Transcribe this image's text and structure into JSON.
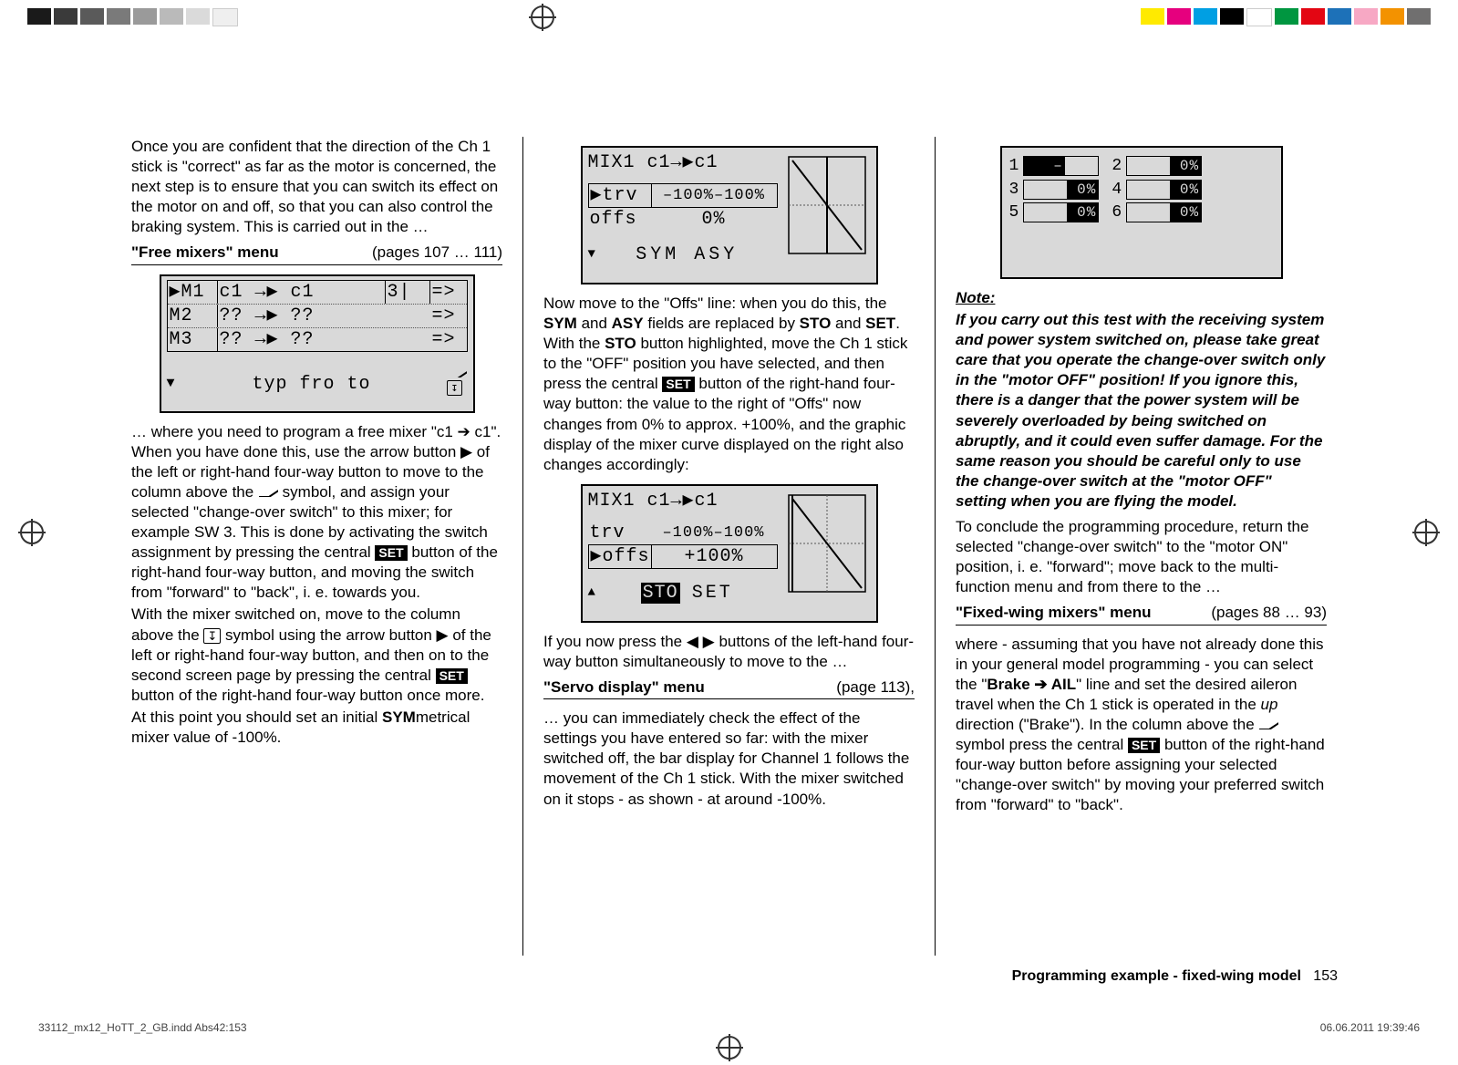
{
  "col1": {
    "p1": "Once you are confident that the direction of the Ch 1 stick is \"correct\" as far as the motor is concerned, the next step is to ensure that you can switch its effect on the motor on and off, so that you can also control the braking system. This is carried out in the …",
    "menu1_label": "\"Free mixers\" menu",
    "menu1_pages": "(pages 107 … 111)",
    "fig1": {
      "rows": [
        {
          "c0": "▶M1",
          "c1": "c1 →▶ c1",
          "c2": "3|",
          "c3": "=>"
        },
        {
          "c0": " M2",
          "c1": "?? →▶ ??",
          "c2": "",
          "c3": "=>"
        },
        {
          "c0": " M3",
          "c1": "?? →▶ ??",
          "c2": "",
          "c3": "=>"
        }
      ],
      "footer_l": "typ   fro     to",
      "footer_r_arrow": "↧"
    },
    "p2a": "… where you need to program a free mixer \"c1 ➔ c1\". When you have done this, use the arrow button ▶ of the left or right-hand four-way button to move to the column above the ",
    "p2b": " symbol, and assign your selected \"change-over switch\" to this mixer; for example SW 3. This is done by activating the switch assignment by pressing the central ",
    "p2c": " button of the right-hand four-way button, and moving the switch from \"forward\" to \"back\", i. e. towards you.",
    "p3a": "With the mixer switched on, move to the column above the ",
    "p3b": " symbol using the arrow button ▶ of the left or right-hand four-way button, and then on to the second screen page by pressing the central ",
    "p3c": " button of the right-hand four-way button once more.",
    "p4a": "At this point you should set an initial ",
    "p4b": "SYM",
    "p4c": "metrical mixer value of -100%."
  },
  "col2": {
    "fig2": {
      "title": "MIX1    c1→▶c1",
      "line1_l": "▶trv",
      "line1_r": "–100%–100%",
      "line2_l": " offs",
      "line2_r": "0%",
      "footer": "SYM ASY"
    },
    "p1a": "Now move to the \"Offs\" line: when you do this, the ",
    "p1b": "SYM",
    "p1c": " and ",
    "p1d": "ASY",
    "p1e": " fields are replaced by ",
    "p1f": "STO",
    "p1g": " and ",
    "p1h": "SET",
    "p1i": ". With the ",
    "p1j": "STO",
    "p1k": " button highlighted, move the Ch 1 stick to the \"OFF\" position you have selected, and then press the central ",
    "p1l": " button of the right-hand four-way button: the value to the right of \"Offs\" now changes from 0% to approx. +100%, and the graphic display of the mixer curve displayed on the right also changes accordingly:",
    "fig3": {
      "title": "MIX1    c1→▶c1",
      "line1_l": " trv",
      "line1_r": "–100%–100%",
      "line2_l": "▶offs",
      "line2_r": "+100%",
      "footer_l": "STO",
      "footer_r": "SET"
    },
    "p2": "If you now press the ◀ ▶ buttons of the left-hand four-way button simultaneously to move to the …",
    "menu2_label": "\"Servo display\" menu",
    "menu2_pages": "(page 113),",
    "p3": "… you can immediately check the effect of the settings you have entered so far: with the mixer switched off, the bar display for Channel 1 follows the movement of the Ch 1 stick. With the mixer switched on it stops - as shown - at around -100%."
  },
  "col3": {
    "fig4": {
      "rows": [
        {
          "n": "1",
          "v": "–100%",
          "n2": "2",
          "v2": "0%"
        },
        {
          "n": "3",
          "v": "0%",
          "n2": "4",
          "v2": "0%"
        },
        {
          "n": "5",
          "v": "0%",
          "n2": "6",
          "v2": "0%"
        }
      ]
    },
    "note_h": "Note:",
    "note_body": "If you carry out this test with the receiving system and power system switched on, please take great care that you operate the change-over switch only in the \"motor OFF\" position! If you ignore this, there is a danger that the power system will be severely overloaded by being switched on abruptly, and it could even suffer damage. For the same reason you should be careful only to use the change-over switch at the \"motor OFF\" setting when you are flying the model.",
    "p1": "To conclude the programming procedure, return the selected \"change-over switch\" to the \"motor ON\" position, i. e. \"forward\"; move back to the multi-function menu and from there to the …",
    "menu3_label": "\"Fixed-wing mixers\" menu",
    "menu3_pages": "(pages 88 … 93)",
    "p2a": "where - assuming that you have not already done this in your general model programming - you can select the \"",
    "p2b": "Brake ➔ AIL",
    "p2c": "\" line and set the desired aileron travel when the Ch 1 stick is operated in the ",
    "p2d": "up",
    "p2e": " direction (\"Brake\"). In the column above the ",
    "p2f": " symbol press the central ",
    "p2g": " button of the right-hand four-way button before assigning your selected \"change-over switch\" by moving your preferred switch from \"forward\" to \"back\"."
  },
  "footer": {
    "label": "Programming example - fixed-wing model",
    "page": "153"
  },
  "micro": {
    "left": "33112_mx12_HoTT_2_GB.indd   Abs42:153",
    "right": "06.06.2011   19:39:46"
  },
  "labels": {
    "set": "SET"
  },
  "colors": {
    "grays": [
      "#1a1a1a",
      "#3a3a3a",
      "#5a5a5a",
      "#7a7a7a",
      "#9a9a9a",
      "#bababa",
      "#dadada",
      "#efefef"
    ],
    "right": [
      "#ffea00",
      "#e6007e",
      "#009fe3",
      "#000000",
      "#ffffff",
      "#009640",
      "#e30613",
      "#1d71b8",
      "#e6007e",
      "#f39200",
      "#706f6f"
    ]
  }
}
